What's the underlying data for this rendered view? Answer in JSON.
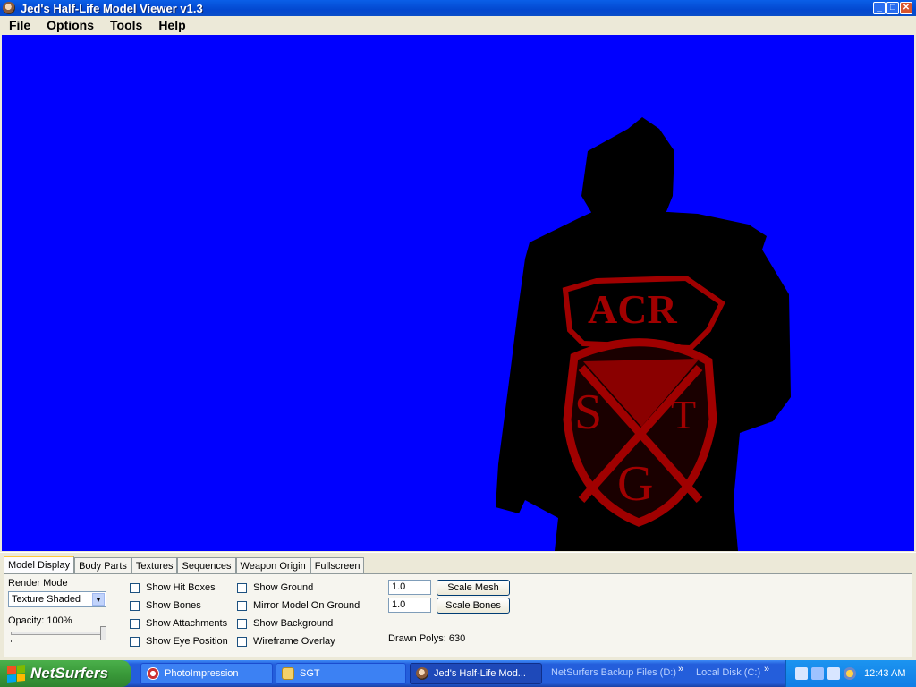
{
  "window": {
    "title": "Jed's Half-Life Model Viewer v1.3",
    "buttons": {
      "minimize": "_",
      "maximize": "□",
      "close": "✕"
    }
  },
  "menu": [
    "File",
    "Options",
    "Tools",
    "Help"
  ],
  "viewport": {
    "background_color": "#0000ff",
    "model_text": {
      "top": "ACR",
      "left": "S",
      "right": "T",
      "bottom": "G"
    }
  },
  "tabs": [
    "Model Display",
    "Body Parts",
    "Textures",
    "Sequences",
    "Weapon Origin",
    "Fullscreen"
  ],
  "model_display": {
    "render_mode_label": "Render Mode",
    "render_mode_value": "Texture Shaded",
    "opacity_label": "Opacity: 100%",
    "opacity_value": 1.0,
    "checkboxes_col1": [
      "Show Hit Boxes",
      "Show Bones",
      "Show Attachments",
      "Show Eye Position"
    ],
    "checkboxes_col2": [
      "Show Ground",
      "Mirror Model On Ground",
      "Show Background",
      "Wireframe Overlay"
    ],
    "scale_mesh_value": "1.0",
    "scale_bones_value": "1.0",
    "scale_mesh_button": "Scale Mesh",
    "scale_bones_button": "Scale Bones",
    "drawn_polys": "Drawn Polys: 630"
  },
  "taskbar": {
    "start_label": "NetSurfers",
    "tasks": [
      "PhotoImpression",
      "SGT",
      "Jed's Half-Life Mod..."
    ],
    "toolbars": [
      "NetSurfers Backup Files (D:)",
      "Local Disk (C:)"
    ],
    "chevron": "»",
    "clock": "12:43 AM"
  }
}
